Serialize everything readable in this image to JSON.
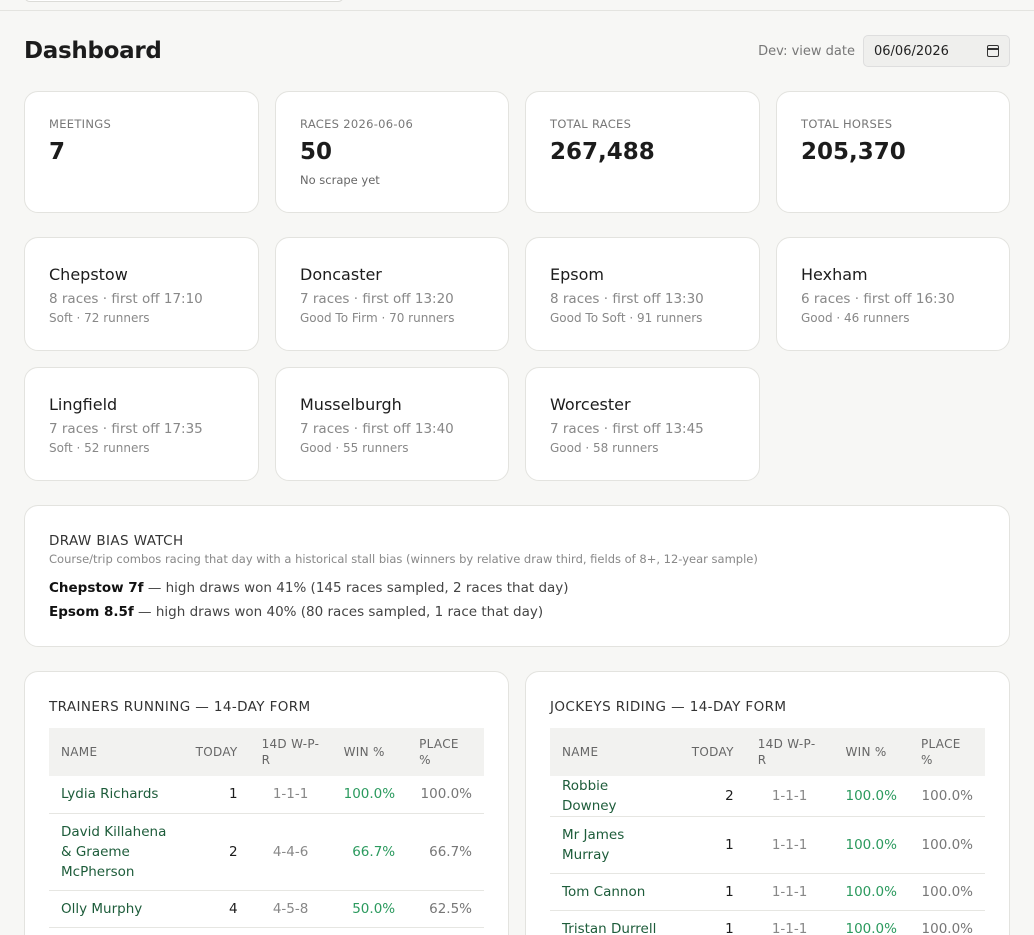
{
  "page": {
    "title": "Dashboard"
  },
  "date_control": {
    "label": "Dev: view date",
    "value": "06/06/2026"
  },
  "stats": [
    {
      "label": "MEETINGS",
      "value": "7",
      "sub": ""
    },
    {
      "label": "RACES 2026-06-06",
      "value": "50",
      "sub": "No scrape yet"
    },
    {
      "label": "TOTAL RACES",
      "value": "267,488",
      "sub": ""
    },
    {
      "label": "TOTAL HORSES",
      "value": "205,370",
      "sub": ""
    }
  ],
  "meetings": [
    {
      "name": "Chepstow",
      "line1": "8 races · first off 17:10",
      "line2": "Soft · 72 runners"
    },
    {
      "name": "Doncaster",
      "line1": "7 races · first off 13:20",
      "line2": "Good To Firm · 70 runners"
    },
    {
      "name": "Epsom",
      "line1": "8 races · first off 13:30",
      "line2": "Good To Soft · 91 runners"
    },
    {
      "name": "Hexham",
      "line1": "6 races · first off 16:30",
      "line2": "Good · 46 runners"
    },
    {
      "name": "Lingfield",
      "line1": "7 races · first off 17:35",
      "line2": "Soft · 52 runners"
    },
    {
      "name": "Musselburgh",
      "line1": "7 races · first off 13:40",
      "line2": "Good · 55 runners"
    },
    {
      "name": "Worcester",
      "line1": "7 races · first off 13:45",
      "line2": "Good · 58 runners"
    }
  ],
  "draw_bias": {
    "title": "DRAW BIAS WATCH",
    "description": "Course/trip combos racing that day with a historical stall bias (winners by relative draw third, fields of 8+, 12-year sample)",
    "rows": [
      {
        "course": "Chepstow 7f",
        "text": " — high draws won 41% (145 races sampled, 2 races that day)"
      },
      {
        "course": "Epsom 8.5f",
        "text": " — high draws won 40% (80 races sampled, 1 race that day)"
      }
    ]
  },
  "trainers": {
    "title": "TRAINERS RUNNING — 14-DAY FORM",
    "columns": [
      "NAME",
      "TODAY",
      "14D W-P-R",
      "WIN %",
      "PLACE %"
    ],
    "rows": [
      {
        "name": "Lydia Richards",
        "today": "1",
        "wpr": "1-1-1",
        "win": "100.0%",
        "place": "100.0%"
      },
      {
        "name": "David Killahena & Graeme McPherson",
        "today": "2",
        "wpr": "4-4-6",
        "win": "66.7%",
        "place": "66.7%"
      },
      {
        "name": "Olly Murphy",
        "today": "4",
        "wpr": "4-5-8",
        "win": "50.0%",
        "place": "62.5%"
      }
    ]
  },
  "jockeys": {
    "title": "JOCKEYS RIDING — 14-DAY FORM",
    "columns": [
      "NAME",
      "TODAY",
      "14D W-P-R",
      "WIN %",
      "PLACE %"
    ],
    "rows": [
      {
        "name": "Robbie Downey",
        "today": "2",
        "wpr": "1-1-1",
        "win": "100.0%",
        "place": "100.0%"
      },
      {
        "name": "Mr James Murray",
        "today": "1",
        "wpr": "1-1-1",
        "win": "100.0%",
        "place": "100.0%"
      },
      {
        "name": "Tom Cannon",
        "today": "1",
        "wpr": "1-1-1",
        "win": "100.0%",
        "place": "100.0%"
      },
      {
        "name": "Tristan Durrell",
        "today": "1",
        "wpr": "1-1-1",
        "win": "100.0%",
        "place": "100.0%"
      }
    ]
  },
  "colors": {
    "accent_green": "#2b9a5e",
    "link_green": "#1d5c3a",
    "background": "#f7f7f5"
  }
}
